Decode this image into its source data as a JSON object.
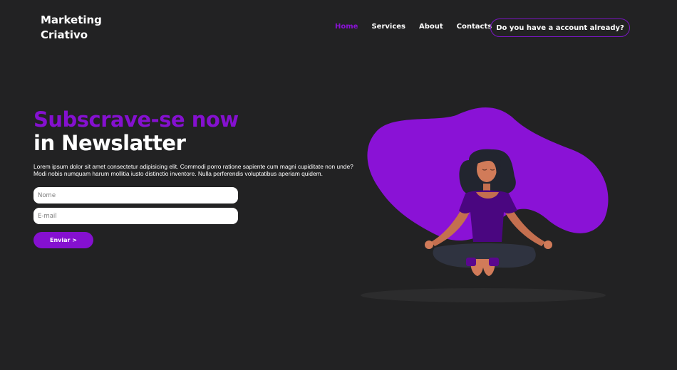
{
  "header": {
    "logo_line1": "Marketing",
    "logo_line2": "Criativo",
    "nav": [
      {
        "label": "Home",
        "active": true
      },
      {
        "label": "Services"
      },
      {
        "label": "About"
      },
      {
        "label": "Contacts"
      }
    ],
    "account_button": "Do you have a account already?"
  },
  "hero": {
    "title_line1": "Subscrave-se now",
    "title_line2": "in Newslatter",
    "description": "Lorem ipsum dolor sit amet consectetur adipisicing elit. Commodi porro ratione sapiente cum magni cupiditate non unde? Modi nobis numquam harum mollitia iusto distinctio inventore. Nulla perferendis voluptatibus aperiam quidem.",
    "form": {
      "name_placeholder": "Nome",
      "email_placeholder": "E-mail",
      "submit_label": "Enviar >"
    }
  },
  "colors": {
    "background": "#222223",
    "accent": "#8510d0",
    "blob": "#8a12d6",
    "text": "#ffffff"
  }
}
